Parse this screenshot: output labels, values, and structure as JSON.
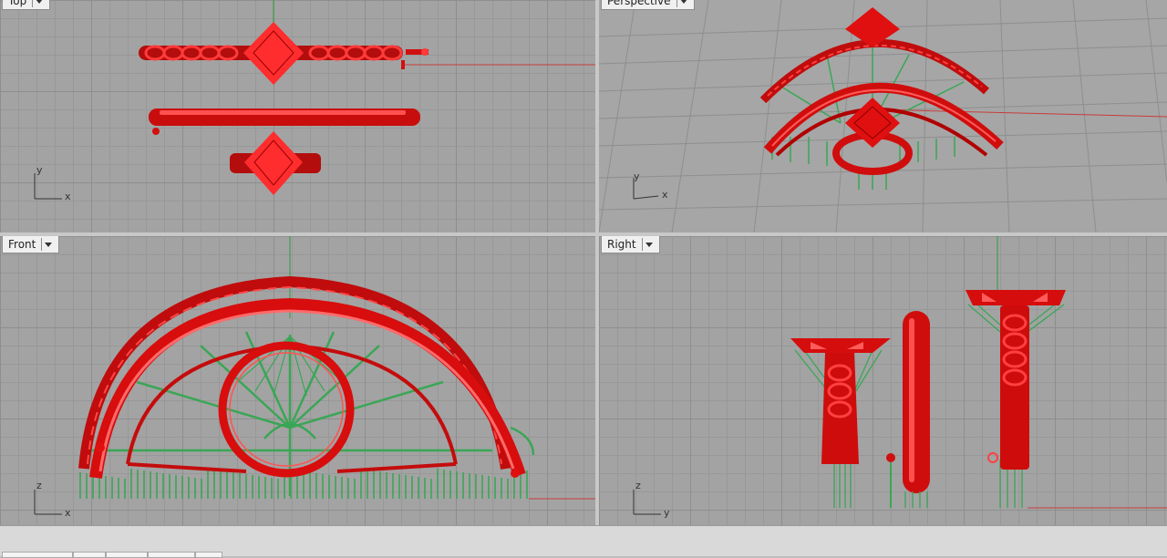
{
  "viewports": {
    "top": {
      "label": "Top",
      "axis_h": "x",
      "axis_v": "y"
    },
    "persp": {
      "label": "Perspective",
      "axis_h": "x",
      "axis_v": "y"
    },
    "front": {
      "label": "Front",
      "axis_h": "x",
      "axis_v": "z"
    },
    "right": {
      "label": "Right",
      "axis_h": "y",
      "axis_v": "z"
    }
  },
  "colors": {
    "model": "#e01010",
    "supports": "#3aa655",
    "x_axis": "#c83c3c",
    "y_axis": "#2f9e3f",
    "grid": "#8e8e8e"
  },
  "icons": {
    "viewport_menu": "chevron-down-icon"
  }
}
